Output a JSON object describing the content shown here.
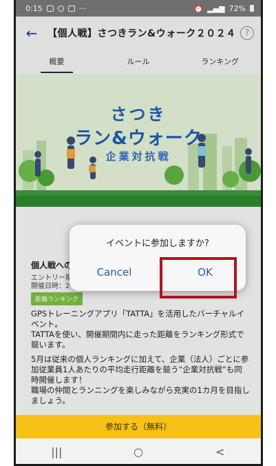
{
  "status_bar": {
    "time": "0:15",
    "battery": "72%"
  },
  "header": {
    "back_icon": "back-arrow-icon",
    "title": "【個人戦】さつきラン&ウォーク２０２４",
    "help_icon": "help-icon"
  },
  "tabs": [
    {
      "label": "概要",
      "active": true
    },
    {
      "label": "ルール",
      "active": false
    },
    {
      "label": "ランキング",
      "active": false
    }
  ],
  "banner": {
    "line1": "さつき",
    "line2": "ラン&ウォーク",
    "line3": "企業対抗戦"
  },
  "content": {
    "section_title": "個人戦への",
    "entry_line1": "エントリー期",
    "entry_line2": "開催日時：2",
    "tag": "距離ランキング",
    "para1": "GPSトレーニングアプリ「TATTA」を活用したバーチャルイベント。\nTATTAを使い、開催期間内に走った距離をランキング形式で競います。",
    "para2": "5月は従来の個人ランキングに加えて、企業（法人）ごとに参加従業員1人あたりの平均走行距離を競う“企業対抗戦”も同時開催します！\n職場の仲間とランニングを楽しみながら充実の1カ月を目指しましょう。"
  },
  "dialog": {
    "message": "イベントに参加しますか?",
    "cancel_label": "Cancel",
    "ok_label": "OK"
  },
  "cta": {
    "label": "参加する（無料）"
  },
  "navbar": {
    "recent_icon": "|||",
    "home_icon": "○",
    "back_icon": "<"
  },
  "colors": {
    "accent_blue": "#1e5fb4",
    "cta_yellow": "#f7c215",
    "highlight_red": "#b3121e",
    "tag_green": "#7bc142"
  }
}
